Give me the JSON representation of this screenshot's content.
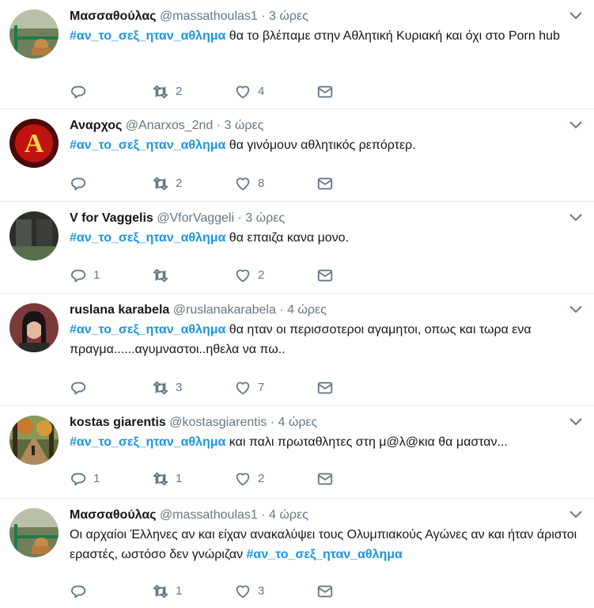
{
  "tweets": [
    {
      "name": "Μασσαθούλας",
      "handle": "@massathoulas1",
      "separator": "·",
      "time": "3 ώρες",
      "hashtag": "#αν_το_σεξ_ηταν_αθλημα",
      "text": " θα το βλέπαμε  στην Αθλητική  Κυριακή και όχι στο Porn hub",
      "reply_count": "",
      "retweet_count": "2",
      "like_count": "4",
      "avatar": "green-railing-photo"
    },
    {
      "name": "Αναρχος",
      "handle": "@Anarxos_2nd",
      "separator": "·",
      "time": "3 ώρες",
      "hashtag": "#αν_το_σεξ_ηταν_αθλημα",
      "text": " θα γινόμουν  αθλητικός ρεπόρτερ.",
      "reply_count": "",
      "retweet_count": "2",
      "like_count": "8",
      "avatar": "anarchy-a-logo"
    },
    {
      "name": "V for Vaggelis",
      "handle": "@VforVaggeli",
      "separator": "·",
      "time": "3 ώρες",
      "hashtag": "#αν_το_σεξ_ηταν_αθλημα",
      "text": " θα επαιζα κανα μονο.",
      "reply_count": "1",
      "retweet_count": "",
      "like_count": "2",
      "avatar": "dark-window-photo"
    },
    {
      "name": "ruslana karabela",
      "handle": "@ruslanakarabela",
      "separator": "·",
      "time": "4 ώρες",
      "hashtag": "#αν_το_σεξ_ηταν_αθλημα",
      "text": " θα ηταν οι περισσοτεροι αγαμητοι, οπως και τωρα ενα πραγμα......αγυμναστοι..ηθελα να πω..",
      "reply_count": "",
      "retweet_count": "3",
      "like_count": "7",
      "avatar": "woman-portrait-photo"
    },
    {
      "name": "kostas giarentis",
      "handle": "@kostasgiarentis",
      "separator": "·",
      "time": "4 ώρες",
      "hashtag": "#αν_το_σεξ_ηταν_αθλημα",
      "text": " και παλι πρωταθλητες στη μ@λ@κια θα μασταν...",
      "reply_count": "1",
      "retweet_count": "1",
      "like_count": "2",
      "avatar": "autumn-path-photo"
    },
    {
      "name": "Μασσαθούλας",
      "handle": "@massathoulas1",
      "separator": "·",
      "time": "4 ώρες",
      "hashtag": "#αν_το_σεξ_ηταν_αθλημα",
      "text": "Οι αρχαίοι  Έλληνες αν και είχαν ανακαλύψει τους Ολυμπιακούς Αγώνες αν και ήταν άριστοι εραστές, ωστόσο δεν γνώριζαν  ",
      "reply_count": "",
      "retweet_count": "1",
      "like_count": "3",
      "avatar": "green-railing-photo"
    }
  ]
}
